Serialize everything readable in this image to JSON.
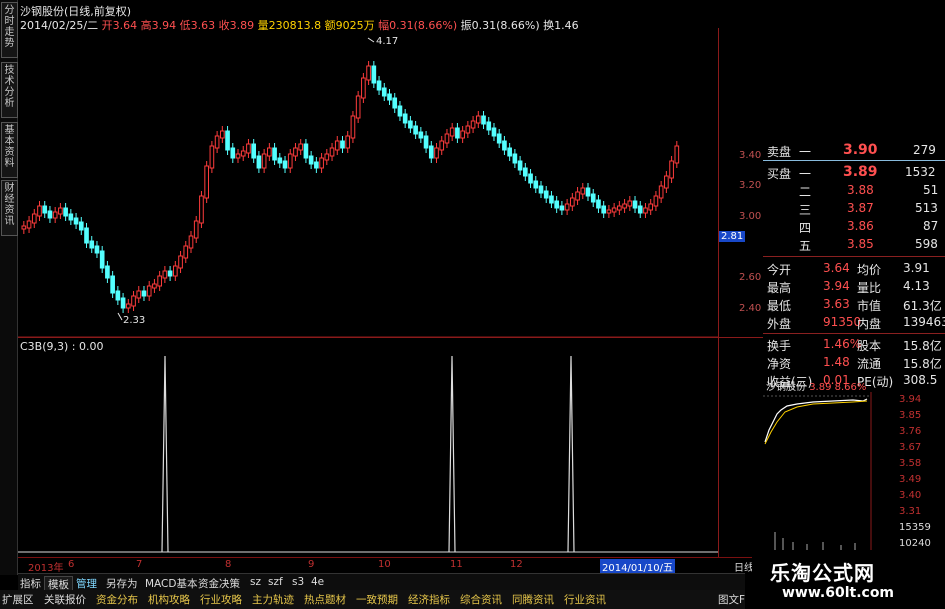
{
  "left_tabs": [
    "分时走势",
    "技术分析",
    "基本资料",
    "财经资讯"
  ],
  "header": {
    "line1": "沙钢股份(日线,前复权)",
    "date": "2014/02/25/二",
    "open_label": "开",
    "open": "3.64",
    "high_label": "高",
    "high": "3.94",
    "low_label": "低",
    "low": "3.63",
    "close_label": "收",
    "close": "3.89",
    "vol_label": "量",
    "vol": "230813.8",
    "amt_label": "额",
    "amt": "9025万",
    "chg_label": "幅",
    "chg": "0.31(8.66%)",
    "amp_label": "振",
    "amp": "0.31(8.66%)",
    "turn_label": "换",
    "turn": "1.46"
  },
  "kline": {
    "y_ticks": [
      "3.40",
      "3.20",
      "3.00",
      "2.80",
      "2.60",
      "2.40"
    ],
    "current_price_tag": "2.81",
    "max_label": "4.17",
    "min_label": "2.33",
    "colors": {
      "up": "#ff3c3c",
      "down": "#54ffff",
      "axis": "#8a1a1a"
    }
  },
  "indicator": {
    "title": "C3B(9,3) : 0.00",
    "spikes_at": [
      0.21,
      0.62,
      0.79
    ]
  },
  "date_axis": {
    "ticks": [
      "2013年",
      "6",
      "7",
      "8",
      "9",
      "10",
      "11",
      "12",
      "2014/01/10/五"
    ],
    "right": "日线"
  },
  "toolbar1": [
    "指标",
    "模板",
    "管理",
    "另存为",
    "MACD基本",
    "资金决策",
    "sz",
    "szf",
    "s3",
    "4e"
  ],
  "toolbar2": [
    "扩展区",
    "关联报价",
    "资金分布",
    "机构攻略",
    "行业攻略",
    "主力轨迹",
    "热点题材",
    "一致预期",
    "经济指标",
    "综合资讯",
    "同腾资讯",
    "行业资讯"
  ],
  "toolbar2_right": "图文F",
  "quote": {
    "sell_label": "卖盘",
    "sell_level": "一",
    "sell_price": "3.90",
    "sell_vol": "279",
    "buy_rows": [
      {
        "label": "买盘",
        "level": "一",
        "price": "3.89",
        "vol": "1532"
      },
      {
        "label": "",
        "level": "二",
        "price": "3.88",
        "vol": "51"
      },
      {
        "label": "",
        "level": "三",
        "price": "3.87",
        "vol": "513"
      },
      {
        "label": "",
        "level": "四",
        "price": "3.86",
        "vol": "87"
      },
      {
        "label": "",
        "level": "五",
        "price": "3.85",
        "vol": "598"
      }
    ],
    "stats": [
      {
        "l1": "今开",
        "v1": "3.64",
        "l2": "均价",
        "v2": "3.91"
      },
      {
        "l1": "最高",
        "v1": "3.94",
        "l2": "量比",
        "v2": "4.13"
      },
      {
        "l1": "最低",
        "v1": "3.63",
        "l2": "市值",
        "v2": "61.3亿"
      },
      {
        "l1": "外盘",
        "v1": "91350",
        "l2": "内盘",
        "v2": "139463"
      }
    ],
    "stats2": [
      {
        "l1": "换手",
        "v1": "1.46%",
        "l2": "股本",
        "v2": "15.8亿"
      },
      {
        "l1": "净资",
        "v1": "1.48",
        "l2": "流通",
        "v2": "15.8亿"
      },
      {
        "l1": "收益(三)",
        "v1": "0.01",
        "l2": "PE(动)",
        "v2": "308.5"
      }
    ]
  },
  "mini": {
    "title": "沙钢股份",
    "price": "3.89",
    "pct": "8.66%",
    "y_ticks": [
      "3.94",
      "3.85",
      "3.76",
      "3.67",
      "3.58",
      "3.49",
      "3.40",
      "3.31"
    ],
    "vol_ticks": [
      "15359",
      "10240"
    ]
  },
  "logo": {
    "line1": "乐淘公式网",
    "line2": "www.60lt.com"
  }
}
